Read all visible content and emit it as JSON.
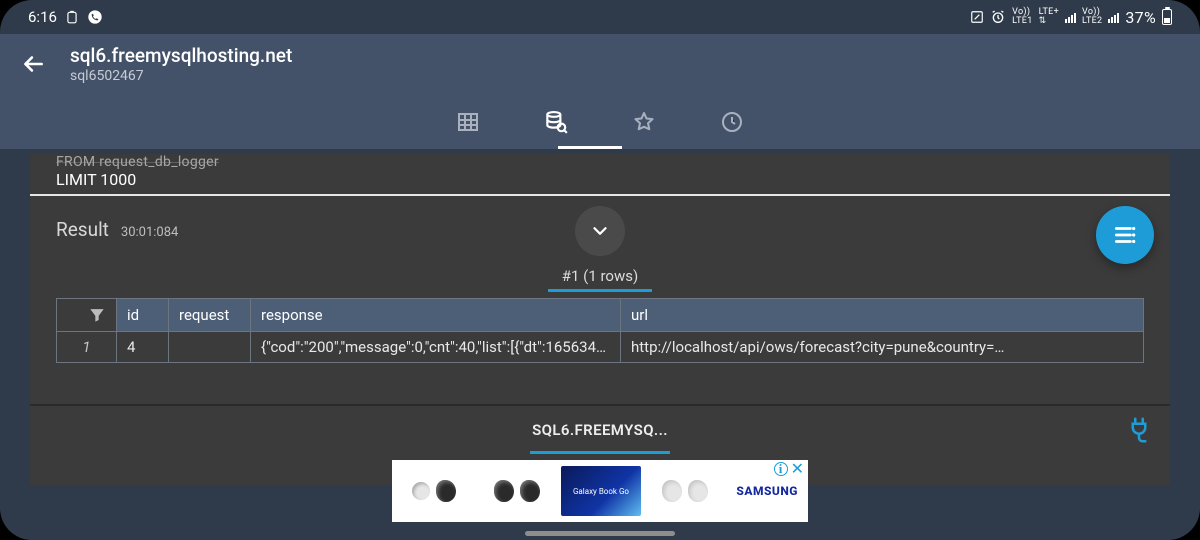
{
  "status": {
    "time": "6:16",
    "vo1": "Vo))",
    "sim1": "LTE1",
    "lte_plus": "LTE+",
    "vo2": "Vo))",
    "sim2": "LTE2",
    "battery_pct": "37%"
  },
  "header": {
    "host": "sql6.freemysqlhosting.net",
    "db": "sql6502467"
  },
  "sql": {
    "prev_line": "FROM request_db_logger",
    "line": "LIMIT 1000"
  },
  "result": {
    "label": "Result",
    "time": "30:01:084",
    "tab_label": "#1 (1 rows)"
  },
  "table": {
    "headers": {
      "idx": "",
      "id": "id",
      "request": "request",
      "response": "response",
      "url": "url"
    },
    "rows": [
      {
        "n": "1",
        "id": "4",
        "request": "",
        "response": "{\"cod\":\"200\",\"message\":0,\"cnt\":40,\"list\":[{\"dt\":1656342000…",
        "url": "http://localhost/api/ows/forecast?city=pune&country=…"
      }
    ]
  },
  "bottom": {
    "host_short": "SQL6.FREEMYSQ..."
  },
  "ad": {
    "screen_text": "Galaxy Book Go",
    "brand": "SAMSUNG"
  }
}
